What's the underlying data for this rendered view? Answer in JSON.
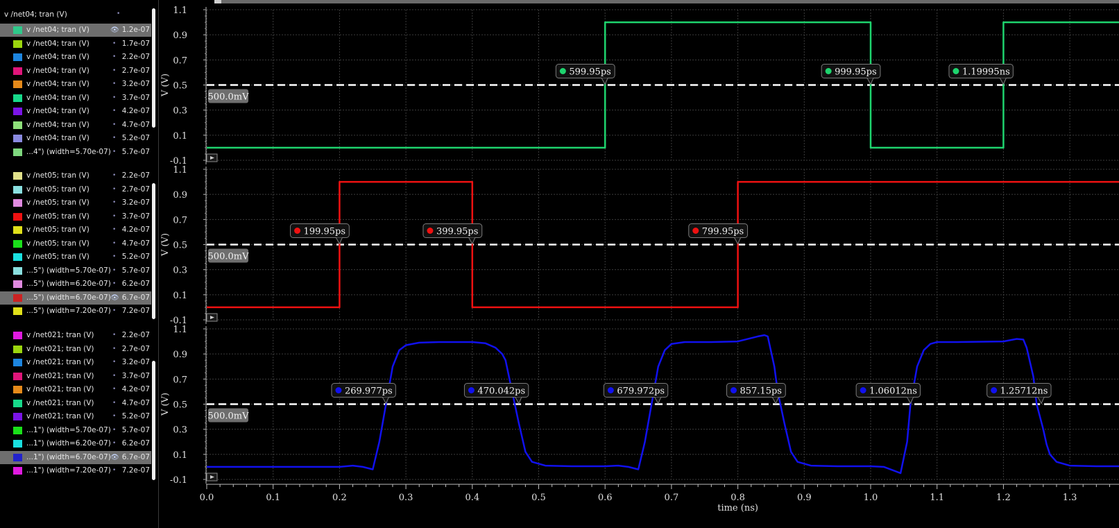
{
  "legend": {
    "root": {
      "label": "v /net04; tran (V)"
    },
    "groups": [
      {
        "items": [
          {
            "label": "v /net04; tran (V)",
            "value": "1.2e-07",
            "color": "#2fc88a",
            "highlighted": true,
            "eye": true
          },
          {
            "label": "v /net04; tran (V)",
            "value": "1.7e-07",
            "color": "#9bd60e"
          },
          {
            "label": "v /net04; tran (V)",
            "value": "2.2e-07",
            "color": "#1d86e0"
          },
          {
            "label": "v /net04; tran (V)",
            "value": "2.7e-07",
            "color": "#e0157a"
          },
          {
            "label": "v /net04; tran (V)",
            "value": "3.2e-07",
            "color": "#e68a1a"
          },
          {
            "label": "v /net04; tran (V)",
            "value": "3.7e-07",
            "color": "#17d98a"
          },
          {
            "label": "v /net04; tran (V)",
            "value": "4.2e-07",
            "color": "#7a14e6"
          },
          {
            "label": "v /net04; tran (V)",
            "value": "4.7e-07",
            "color": "#8ee07a"
          },
          {
            "label": "v /net04; tran (V)",
            "value": "5.2e-07",
            "color": "#8a8ae0"
          },
          {
            "label": "...4\") (width=5.70e-07)",
            "value": "5.7e-07",
            "color": "#7ed87e"
          }
        ]
      },
      {
        "items": [
          {
            "label": "v /net05; tran (V)",
            "value": "2.2e-07",
            "color": "#e0e08a"
          },
          {
            "label": "v /net05; tran (V)",
            "value": "2.7e-07",
            "color": "#8ae0e0"
          },
          {
            "label": "v /net05; tran (V)",
            "value": "3.2e-07",
            "color": "#e08ae0"
          },
          {
            "label": "v /net05; tran (V)",
            "value": "3.7e-07",
            "color": "#ee1111"
          },
          {
            "label": "v /net05; tran (V)",
            "value": "4.2e-07",
            "color": "#e0e01a"
          },
          {
            "label": "v /net05; tran (V)",
            "value": "4.7e-07",
            "color": "#1ae01a"
          },
          {
            "label": "v /net05; tran (V)",
            "value": "5.2e-07",
            "color": "#1ae0e0"
          },
          {
            "label": "...5\") (width=5.70e-07)",
            "value": "5.7e-07",
            "color": "#8ae0e0"
          },
          {
            "label": "...5\") (width=6.20e-07)",
            "value": "6.2e-07",
            "color": "#e08ae0"
          },
          {
            "label": "...5\") (width=6.70e-07)",
            "value": "6.7e-07",
            "color": "#cc2222",
            "highlighted": true,
            "eye": true
          },
          {
            "label": "...5\") (width=7.20e-07)",
            "value": "7.2e-07",
            "color": "#e0e01a"
          }
        ]
      },
      {
        "items": [
          {
            "label": "v /net021; tran (V)",
            "value": "2.2e-07",
            "color": "#e01ae0"
          },
          {
            "label": "v /net021; tran (V)",
            "value": "2.7e-07",
            "color": "#9bd60e"
          },
          {
            "label": "v /net021; tran (V)",
            "value": "3.2e-07",
            "color": "#1d86e0"
          },
          {
            "label": "v /net021; tran (V)",
            "value": "3.7e-07",
            "color": "#e0157a"
          },
          {
            "label": "v /net021; tran (V)",
            "value": "4.2e-07",
            "color": "#e68a1a"
          },
          {
            "label": "v /net021; tran (V)",
            "value": "4.7e-07",
            "color": "#17d98a"
          },
          {
            "label": "v /net021; tran (V)",
            "value": "5.2e-07",
            "color": "#7a14e6"
          },
          {
            "label": "...1\") (width=5.70e-07)",
            "value": "5.7e-07",
            "color": "#1ae01a"
          },
          {
            "label": "...1\") (width=6.20e-07)",
            "value": "6.2e-07",
            "color": "#1ae0e0"
          },
          {
            "label": "...1\") (width=6.70e-07)",
            "value": "6.7e-07",
            "color": "#2222cc",
            "highlighted": true,
            "eye": true
          },
          {
            "label": "...1\") (width=7.20e-07)",
            "value": "7.2e-07",
            "color": "#e01ae0"
          }
        ]
      }
    ]
  },
  "chart_data": [
    {
      "type": "line",
      "ylabel": "V (V)",
      "ylim": [
        -0.1,
        1.1
      ],
      "yticks": [
        "1.1",
        "0.9",
        "0.7",
        "0.5",
        "0.3",
        "0.1",
        "-0.1"
      ],
      "xlim": [
        0,
        1.4
      ],
      "threshold": {
        "value": 0.5,
        "label": "500.0mV"
      },
      "series": [
        {
          "color": "#1ed46e",
          "x": [
            0,
            0.6,
            0.6,
            1.0,
            1.0,
            1.2,
            1.2,
            1.4
          ],
          "y": [
            0,
            0,
            1,
            1,
            0,
            0,
            1,
            1
          ]
        }
      ],
      "markers": [
        {
          "x": 0.59995,
          "label": "599.95ps"
        },
        {
          "x": 0.99995,
          "label": "999.95ps"
        },
        {
          "x": 1.19995,
          "label": "1.19995ns"
        }
      ]
    },
    {
      "type": "line",
      "ylabel": "V (V)",
      "ylim": [
        -0.1,
        1.1
      ],
      "yticks": [
        "1.1",
        "0.9",
        "0.7",
        "0.5",
        "0.3",
        "0.1",
        "-0.1"
      ],
      "xlim": [
        0,
        1.4
      ],
      "threshold": {
        "value": 0.5,
        "label": "500.0mV"
      },
      "series": [
        {
          "color": "#ee1111",
          "x": [
            0,
            0.2,
            0.2,
            0.4,
            0.4,
            0.8,
            0.8,
            1.4
          ],
          "y": [
            0,
            0,
            1,
            1,
            0,
            0,
            1,
            1
          ]
        }
      ],
      "markers": [
        {
          "x": 0.19995,
          "label": "199.95ps"
        },
        {
          "x": 0.39995,
          "label": "399.95ps"
        },
        {
          "x": 0.79995,
          "label": "799.95ps"
        }
      ]
    },
    {
      "type": "line",
      "ylabel": "V (V)",
      "ylim": [
        -0.1,
        1.1
      ],
      "yticks": [
        "1.1",
        "0.9",
        "0.7",
        "0.5",
        "0.3",
        "0.1",
        "-0.1"
      ],
      "xlim": [
        0,
        1.4
      ],
      "xticks": [
        "0.0",
        "0.1",
        "0.2",
        "0.3",
        "0.4",
        "0.5",
        "0.6",
        "0.7",
        "0.8",
        "0.9",
        "1.0",
        "1.1",
        "1.2",
        "1.3"
      ],
      "xlabel": "time (ns)",
      "threshold": {
        "value": 0.5,
        "label": "500.0mV"
      },
      "series": [
        {
          "color": "#1111ee",
          "x": [
            0,
            0.2,
            0.22,
            0.235,
            0.25,
            0.26,
            0.27,
            0.28,
            0.29,
            0.3,
            0.32,
            0.35,
            0.4,
            0.42,
            0.435,
            0.445,
            0.45,
            0.46,
            0.47,
            0.48,
            0.49,
            0.51,
            0.55,
            0.6,
            0.62,
            0.635,
            0.65,
            0.66,
            0.67,
            0.68,
            0.69,
            0.7,
            0.72,
            0.76,
            0.8,
            0.83,
            0.84,
            0.845,
            0.855,
            0.86,
            0.87,
            0.88,
            0.89,
            0.91,
            0.95,
            1.0,
            1.02,
            1.035,
            1.045,
            1.055,
            1.06,
            1.07,
            1.08,
            1.09,
            1.1,
            1.13,
            1.2,
            1.22,
            1.23,
            1.235,
            1.245,
            1.25,
            1.26,
            1.265,
            1.27,
            1.28,
            1.3,
            1.34,
            1.4
          ],
          "y": [
            0,
            0,
            0.01,
            0,
            -0.02,
            0.2,
            0.5,
            0.8,
            0.93,
            0.97,
            0.99,
            0.995,
            0.995,
            0.985,
            0.95,
            0.9,
            0.85,
            0.6,
            0.35,
            0.12,
            0.04,
            0.01,
            0.005,
            0.005,
            0.01,
            0,
            -0.02,
            0.2,
            0.5,
            0.8,
            0.93,
            0.98,
            0.995,
            0.995,
            1.0,
            1.04,
            1.05,
            1.04,
            0.8,
            0.6,
            0.35,
            0.12,
            0.04,
            0.01,
            0.005,
            0.005,
            0,
            -0.03,
            -0.05,
            0.2,
            0.5,
            0.8,
            0.93,
            0.98,
            0.995,
            0.995,
            1.0,
            1.02,
            1.015,
            0.95,
            0.72,
            0.5,
            0.3,
            0.18,
            0.1,
            0.04,
            0.01,
            0.005,
            0.005
          ]
        }
      ],
      "markers": [
        {
          "x": 0.269977,
          "label": "269.977ps"
        },
        {
          "x": 0.470042,
          "label": "470.042ps"
        },
        {
          "x": 0.679972,
          "label": "679.972ps"
        },
        {
          "x": 0.85715,
          "label": "857.15ps"
        },
        {
          "x": 1.06012,
          "label": "1.06012ns"
        },
        {
          "x": 1.25712,
          "label": "1.25712ns"
        }
      ]
    }
  ]
}
